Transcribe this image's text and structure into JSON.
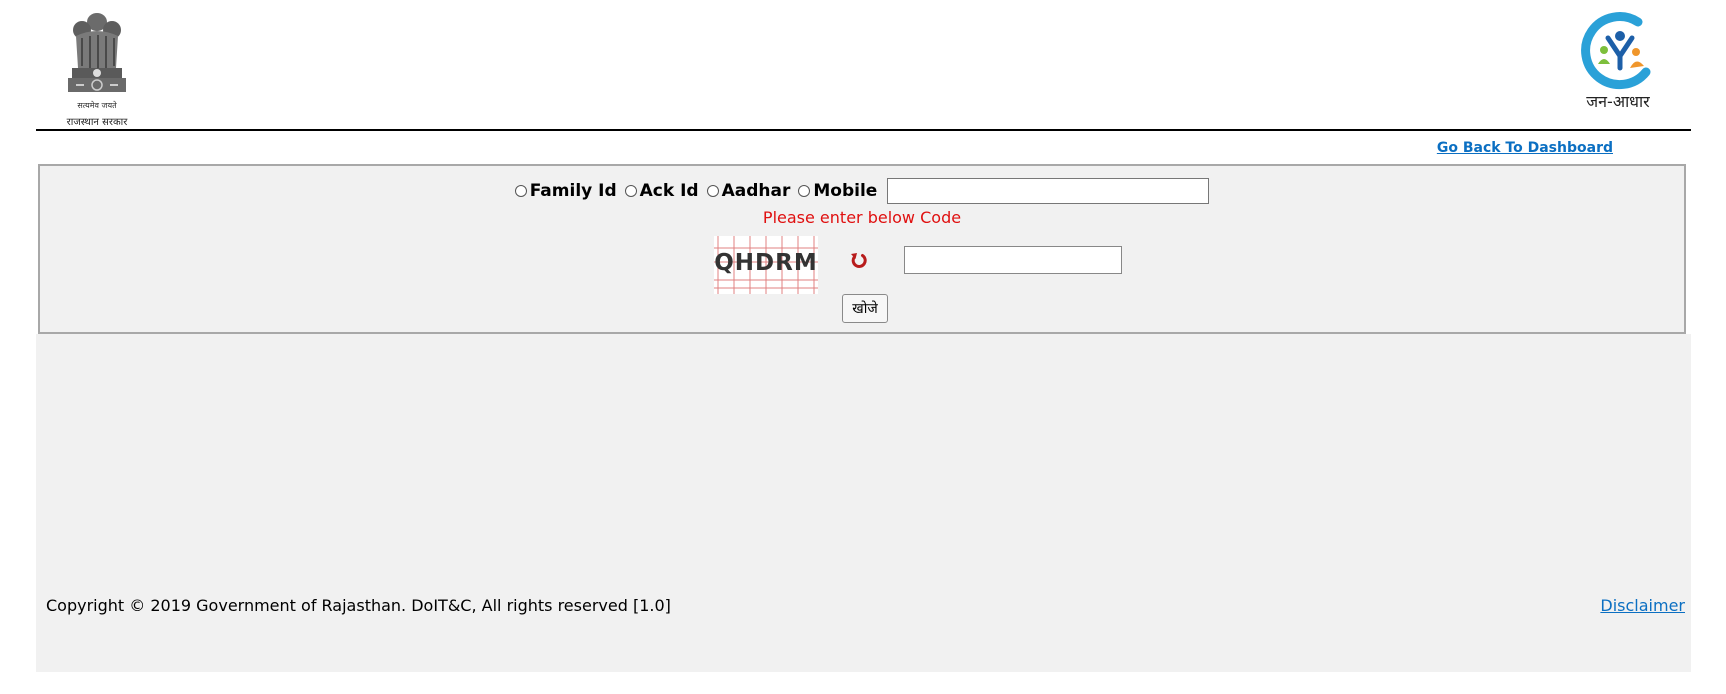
{
  "header": {
    "emblem_motto": "सत्यमेव जयते",
    "emblem_name": "राजस्थान सरकार",
    "logo_text": "जन-आधार"
  },
  "nav": {
    "back_link": "Go Back To Dashboard"
  },
  "search": {
    "options": [
      {
        "label": "Family Id",
        "selected": false
      },
      {
        "label": "Ack Id",
        "selected": false
      },
      {
        "label": "Aadhar",
        "selected": false
      },
      {
        "label": "Mobile",
        "selected": false
      }
    ],
    "id_value": "",
    "code_prompt": "Please enter below Code",
    "captcha_text": "QHDRM",
    "captcha_value": "",
    "submit_label": "खोजे"
  },
  "footer": {
    "copyright": "Copyright © 2019 Government of Rajasthan. DoIT&C, All rights reserved [1.0]",
    "disclaimer": "Disclaimer"
  },
  "colors": {
    "link": "#0b6fc2",
    "prompt": "#e01010",
    "panel_bg": "#f1f1f1",
    "panel_border": "#a8a8a8"
  },
  "icons": {
    "emblem": "state-emblem-icon",
    "logo": "jan-aadhaar-logo-icon",
    "refresh": "refresh-icon"
  }
}
